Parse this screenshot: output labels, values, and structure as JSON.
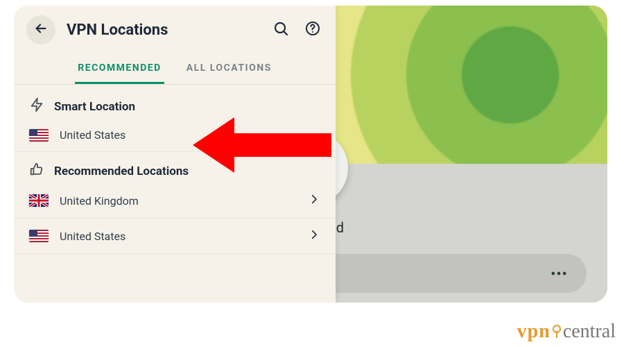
{
  "drawer": {
    "title": "VPN Locations",
    "tabs": {
      "recommended": "RECOMMENDED",
      "all": "ALL LOCATIONS"
    },
    "smart_section": "Smart Location",
    "smart_item": {
      "label": "United States",
      "flag": "us"
    },
    "rec_section": "Recommended Locations",
    "rec_items": [
      {
        "label": "United Kingdom",
        "flag": "uk"
      },
      {
        "label": "United States",
        "flag": "us"
      }
    ]
  },
  "main": {
    "status": "Connected"
  },
  "watermark": {
    "brand_prefix": "vpn",
    "brand_suffix": "central"
  },
  "colors": {
    "accent": "#0c8f68",
    "danger": "#ff0000"
  }
}
